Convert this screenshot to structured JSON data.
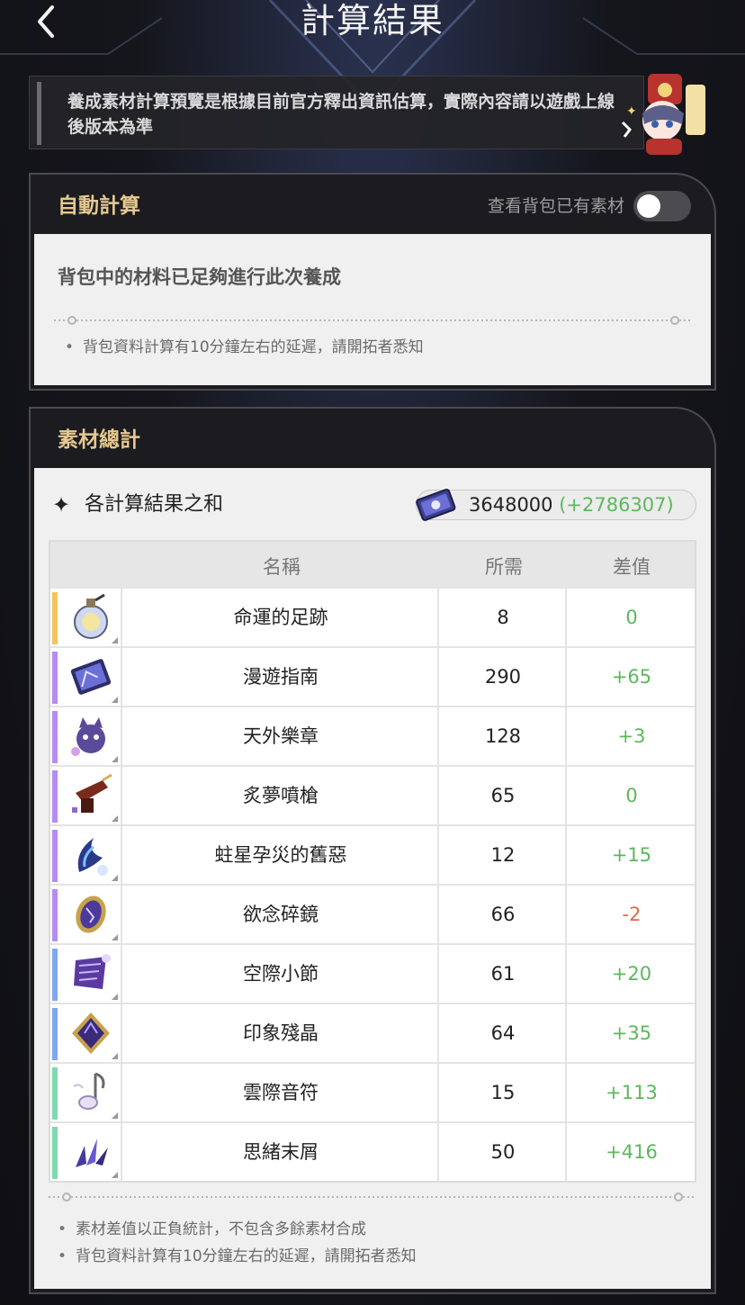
{
  "header": {
    "title": "計算結果",
    "back_icon": "chevron-left-icon"
  },
  "notice": {
    "text": "養成素材計算預覽是根據目前官方釋出資訊估算，實際內容請以遊戲上線後版本為準"
  },
  "auto_calc": {
    "title": "自動計算",
    "toggle_label": "查看背包已有素材",
    "toggle_on": false,
    "status": "背包中的材料已足夠進行此次養成",
    "note": "背包資料計算有10分鐘左右的延遲，請開拓者悉知"
  },
  "materials": {
    "title": "素材總計",
    "sum_label": "各計算結果之和",
    "credit_value": "3648000",
    "credit_diff": "(+2786307)",
    "columns": {
      "name": "名稱",
      "need": "所需",
      "diff": "差值"
    },
    "rows": [
      {
        "name": "命運的足跡",
        "need": "8",
        "diff": "0",
        "rarity_color": "#f2c45a",
        "icon": "flask-icon"
      },
      {
        "name": "漫遊指南",
        "need": "290",
        "diff": "+65",
        "rarity_color": "#b68cf0",
        "icon": "book-icon"
      },
      {
        "name": "天外樂章",
        "need": "128",
        "diff": "+3",
        "rarity_color": "#b68cf0",
        "icon": "music-cat-icon"
      },
      {
        "name": "炙夢噴槍",
        "need": "65",
        "diff": "0",
        "rarity_color": "#b68cf0",
        "icon": "spray-gun-icon"
      },
      {
        "name": "蛀星孕災的舊惡",
        "need": "12",
        "diff": "+15",
        "rarity_color": "#b68cf0",
        "icon": "claw-icon"
      },
      {
        "name": "欲念碎鏡",
        "need": "66",
        "diff": "-2",
        "rarity_color": "#b68cf0",
        "icon": "mirror-icon"
      },
      {
        "name": "空際小節",
        "need": "61",
        "diff": "+20",
        "rarity_color": "#7fa8ef",
        "icon": "scroll-icon"
      },
      {
        "name": "印象殘晶",
        "need": "64",
        "diff": "+35",
        "rarity_color": "#7fa8ef",
        "icon": "crystal-icon"
      },
      {
        "name": "雲際音符",
        "need": "15",
        "diff": "+113",
        "rarity_color": "#7fd9b0",
        "icon": "note-icon"
      },
      {
        "name": "思緒末屑",
        "need": "50",
        "diff": "+416",
        "rarity_color": "#7fd9b0",
        "icon": "shards-icon"
      }
    ],
    "notes": [
      "素材差值以正負統計，不包含多餘素材合成",
      "背包資料計算有10分鐘左右的延遲，請開拓者悉知"
    ]
  },
  "colors": {
    "accent": "#e6c98f",
    "positive": "#5cb85c",
    "negative": "#e4674a"
  }
}
